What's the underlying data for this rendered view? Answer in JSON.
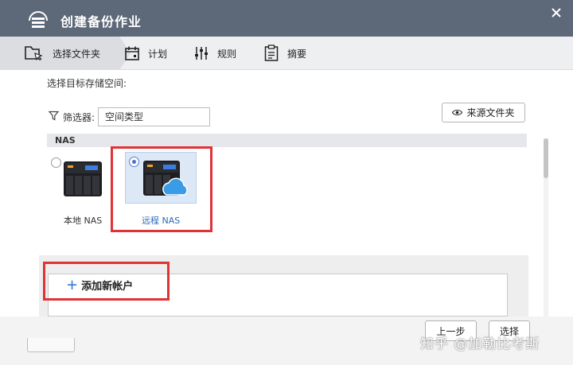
{
  "window": {
    "title": "创建备份作业",
    "app_icon": "backup-app-icon",
    "close_icon": "close-icon"
  },
  "steps": [
    {
      "label": "选择文件夹",
      "icon": "folder-select-icon",
      "active": true
    },
    {
      "label": "计划",
      "icon": "calendar-icon",
      "active": false
    },
    {
      "label": "规则",
      "icon": "sliders-icon",
      "active": false
    },
    {
      "label": "摘要",
      "icon": "clipboard-icon",
      "active": false
    }
  ],
  "main": {
    "section_title": "选择目标存储空间:",
    "filter": {
      "label": "筛选器:",
      "value": "空间类型"
    },
    "source_folder_button": "来源文件夹",
    "nas_group_header": "NAS",
    "nas_options": [
      {
        "label": "本地 NAS",
        "selected": false
      },
      {
        "label": "远程 NAS",
        "selected": true
      }
    ],
    "add_account_label": "添加新帐户"
  },
  "footer": {
    "prev_button": "上一步",
    "select_button": "选择"
  },
  "watermark": "知乎 @加勒比考斯",
  "colors": {
    "title_bar": "#5d6878",
    "highlight_frame": "#e03336",
    "selected_card": "#dde8f6",
    "accent": "#2a73d9",
    "remote_nas_label": "#2b6cb8"
  }
}
